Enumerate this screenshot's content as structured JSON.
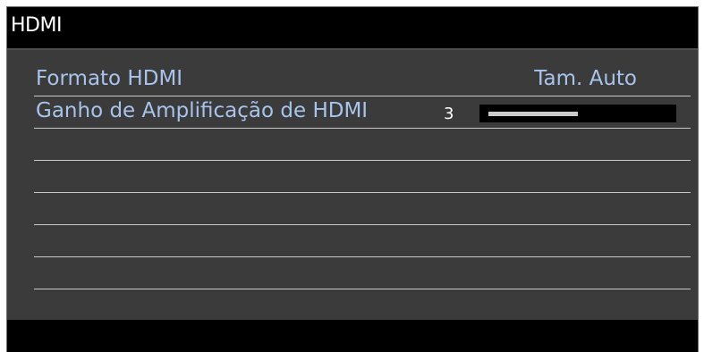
{
  "window": {
    "title": "HDMI"
  },
  "menu": {
    "hdmi_format": {
      "label": "Formato HDMI",
      "value": "Tam. Auto"
    },
    "hdmi_gain": {
      "label": "Ganho de Amplificação de HDMI",
      "value": "3",
      "level_fraction": 0.5
    }
  },
  "empty_row_count": 5,
  "colors": {
    "background": "#3b3b3b",
    "title_bar": "#000000",
    "label_text": "#a8c4ec",
    "divider": "#c8c8c8",
    "slider_fill": "#cccccc"
  }
}
